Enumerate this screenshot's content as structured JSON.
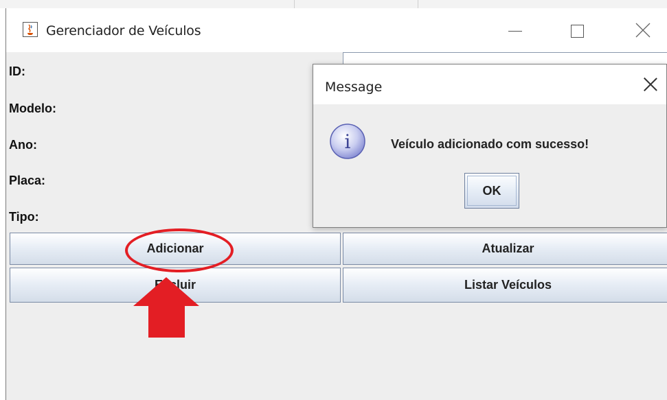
{
  "window": {
    "title": "Gerenciador de Veículos",
    "icon": "java-cup-icon"
  },
  "form": {
    "labels": [
      "ID:",
      "Modelo:",
      "Ano:",
      "Placa:",
      "Tipo:"
    ]
  },
  "buttons": {
    "add": "Adicionar",
    "update": "Atualizar",
    "delete": "Excluir",
    "list": "Listar Veículos"
  },
  "dialog": {
    "title": "Message",
    "message": "Veículo adicionado com sucesso!",
    "ok": "OK",
    "icon": "info-icon"
  },
  "annotation": {
    "color": "#e31e24",
    "target": "Adicionar"
  },
  "colors": {
    "window_bg": "#eeeeee",
    "button_border": "#7a8aa5",
    "annotation_red": "#e31e24"
  }
}
